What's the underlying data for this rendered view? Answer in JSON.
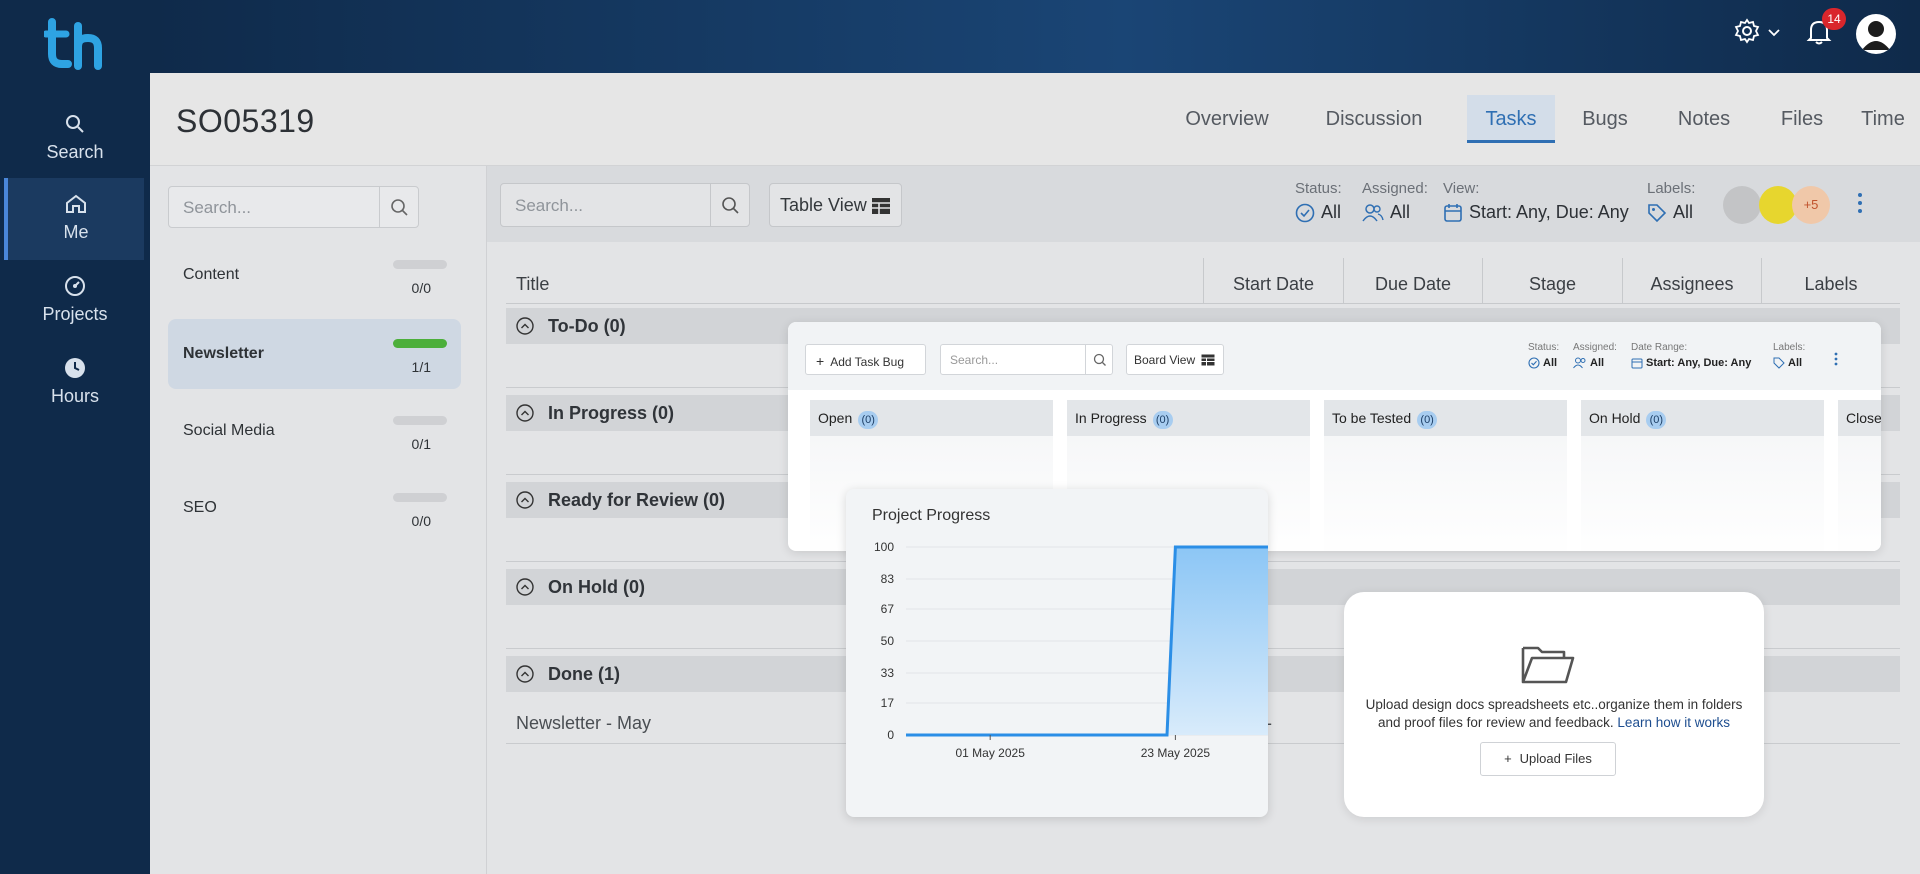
{
  "nav": {
    "items": [
      {
        "label": "Search",
        "icon": "search-icon"
      },
      {
        "label": "Me",
        "icon": "home-icon"
      },
      {
        "label": "Projects",
        "icon": "gauge-icon"
      },
      {
        "label": "Hours",
        "icon": "clock-icon"
      }
    ]
  },
  "header": {
    "notifications": "14"
  },
  "project": {
    "title": "SO05319"
  },
  "tabs": [
    {
      "label": "Overview"
    },
    {
      "label": "Discussion"
    },
    {
      "label": "Tasks"
    },
    {
      "label": "Bugs"
    },
    {
      "label": "Notes"
    },
    {
      "label": "Files"
    },
    {
      "label": "Time"
    }
  ],
  "list": {
    "search_placeholder": "Search...",
    "items": [
      {
        "label": "Content",
        "count": "0/0",
        "progress": 0
      },
      {
        "label": "Newsletter",
        "count": "1/1",
        "progress": 1
      },
      {
        "label": "Social Media",
        "count": "0/1",
        "progress": 0
      },
      {
        "label": "SEO",
        "count": "0/0",
        "progress": 0
      }
    ]
  },
  "toolbar": {
    "search_placeholder": "Search...",
    "view_label": "Table View",
    "status_label": "Status:",
    "status_value": "All",
    "assigned_label": "Assigned:",
    "assigned_value": "All",
    "view_filter_label": "View:",
    "view_filter_value": "Start: Any, Due: Any",
    "labels_label": "Labels:",
    "labels_value": "All",
    "more_assignees": "+5"
  },
  "table": {
    "columns": [
      "Title",
      "Start Date",
      "Due Date",
      "Stage",
      "Assignees",
      "Labels"
    ],
    "groups": [
      {
        "title": "To-Do (0)"
      },
      {
        "title": "In Progress (0)"
      },
      {
        "title": "Ready for Review (0)"
      },
      {
        "title": "On Hold (0)"
      },
      {
        "title": "Done (1)"
      }
    ],
    "done_row": {
      "title": "Newsletter - May",
      "start": "-"
    }
  },
  "board": {
    "add_label": "Add Task Bug",
    "search_placeholder": "Search...",
    "view_label": "Board View",
    "status_label": "Status:",
    "status_value": "All",
    "assigned_label": "Assigned:",
    "assigned_value": "All",
    "range_label": "Date Range:",
    "range_value": "Start: Any, Due: Any",
    "labels_label": "Labels:",
    "labels_value": "All",
    "columns": [
      {
        "name": "Open",
        "count": "(0)"
      },
      {
        "name": "In Progress",
        "count": "(0)"
      },
      {
        "name": "To be Tested",
        "count": "(0)"
      },
      {
        "name": "On Hold",
        "count": "(0)"
      },
      {
        "name": "Close",
        "count": ""
      }
    ]
  },
  "progress_card": {
    "title": "Project Progress"
  },
  "chart_data": {
    "type": "area",
    "title": "Project Progress",
    "x": [
      "2025-04-21",
      "2025-05-01",
      "2025-05-10",
      "2025-05-22",
      "2025-05-23",
      "2025-06-03"
    ],
    "values": [
      0,
      0,
      0,
      0,
      100,
      100
    ],
    "xticks": [
      "01 May 2025",
      "23 May 2025"
    ],
    "yticks": [
      0,
      17,
      33,
      50,
      67,
      83,
      100
    ],
    "ylim": [
      0,
      100
    ],
    "grid": true,
    "color": "#2b8ee6"
  },
  "upload": {
    "text": "Upload design docs spreadsheets etc..organize them in folders and proof files for review and feedback.",
    "link": "Learn how it works",
    "button": "Upload Files"
  },
  "colors": {
    "accent": "#2f6fb3",
    "nav_bg": "#0f2a4a",
    "success": "#4caf3b",
    "badge": "#d9262c"
  }
}
